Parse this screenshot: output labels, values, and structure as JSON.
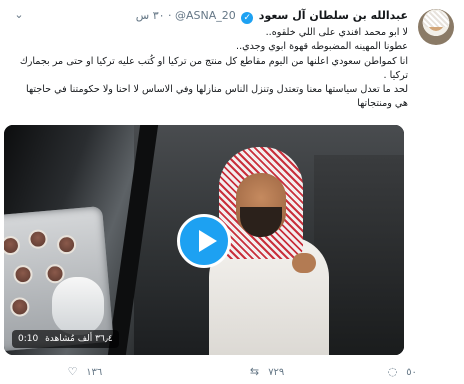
{
  "author": {
    "name": "عبدالله بن سلطان آل سعود",
    "handle": "@ASNA_20",
    "separator": "·",
    "time": "٣٠ س",
    "verified_glyph": "✓"
  },
  "tweet_lines": [
    "لا ابو محمد افندي على اللي خلقوه..",
    "عطونا المهينه المضبوطه قهوة ابوي وجدي..",
    "انا كمواطن سعودي اعلنها من اليوم مقاطع كل منتج من تركيا او كُتب عليه تركيا او حتى مر بجمارك تركيا .",
    "لحد ما تعدل سياستها معنا وتعتدل وتنزل الناس منازلها وفي الاساس لا احنا ولا حكومتنا في حاجتها هي ومنتجاتها"
  ],
  "media": {
    "duration": "0:10",
    "views": "٣٦٫٤ ألف مُشاهدة"
  },
  "actions": {
    "reply": {
      "icon": "reply-icon",
      "glyph": "◌",
      "count": "٥٠"
    },
    "retweet": {
      "icon": "retweet-icon",
      "glyph": "⇆",
      "count": "٧٢٩"
    },
    "like": {
      "icon": "heart-icon",
      "glyph": "♡",
      "count": "١٣٦"
    }
  },
  "colors": {
    "accent": "#1da1f2",
    "secondary_text": "#657786",
    "text": "#14171a"
  },
  "icons": {
    "menu": "chevron-down-icon",
    "menu_glyph": "⌄",
    "play": "play-icon"
  }
}
